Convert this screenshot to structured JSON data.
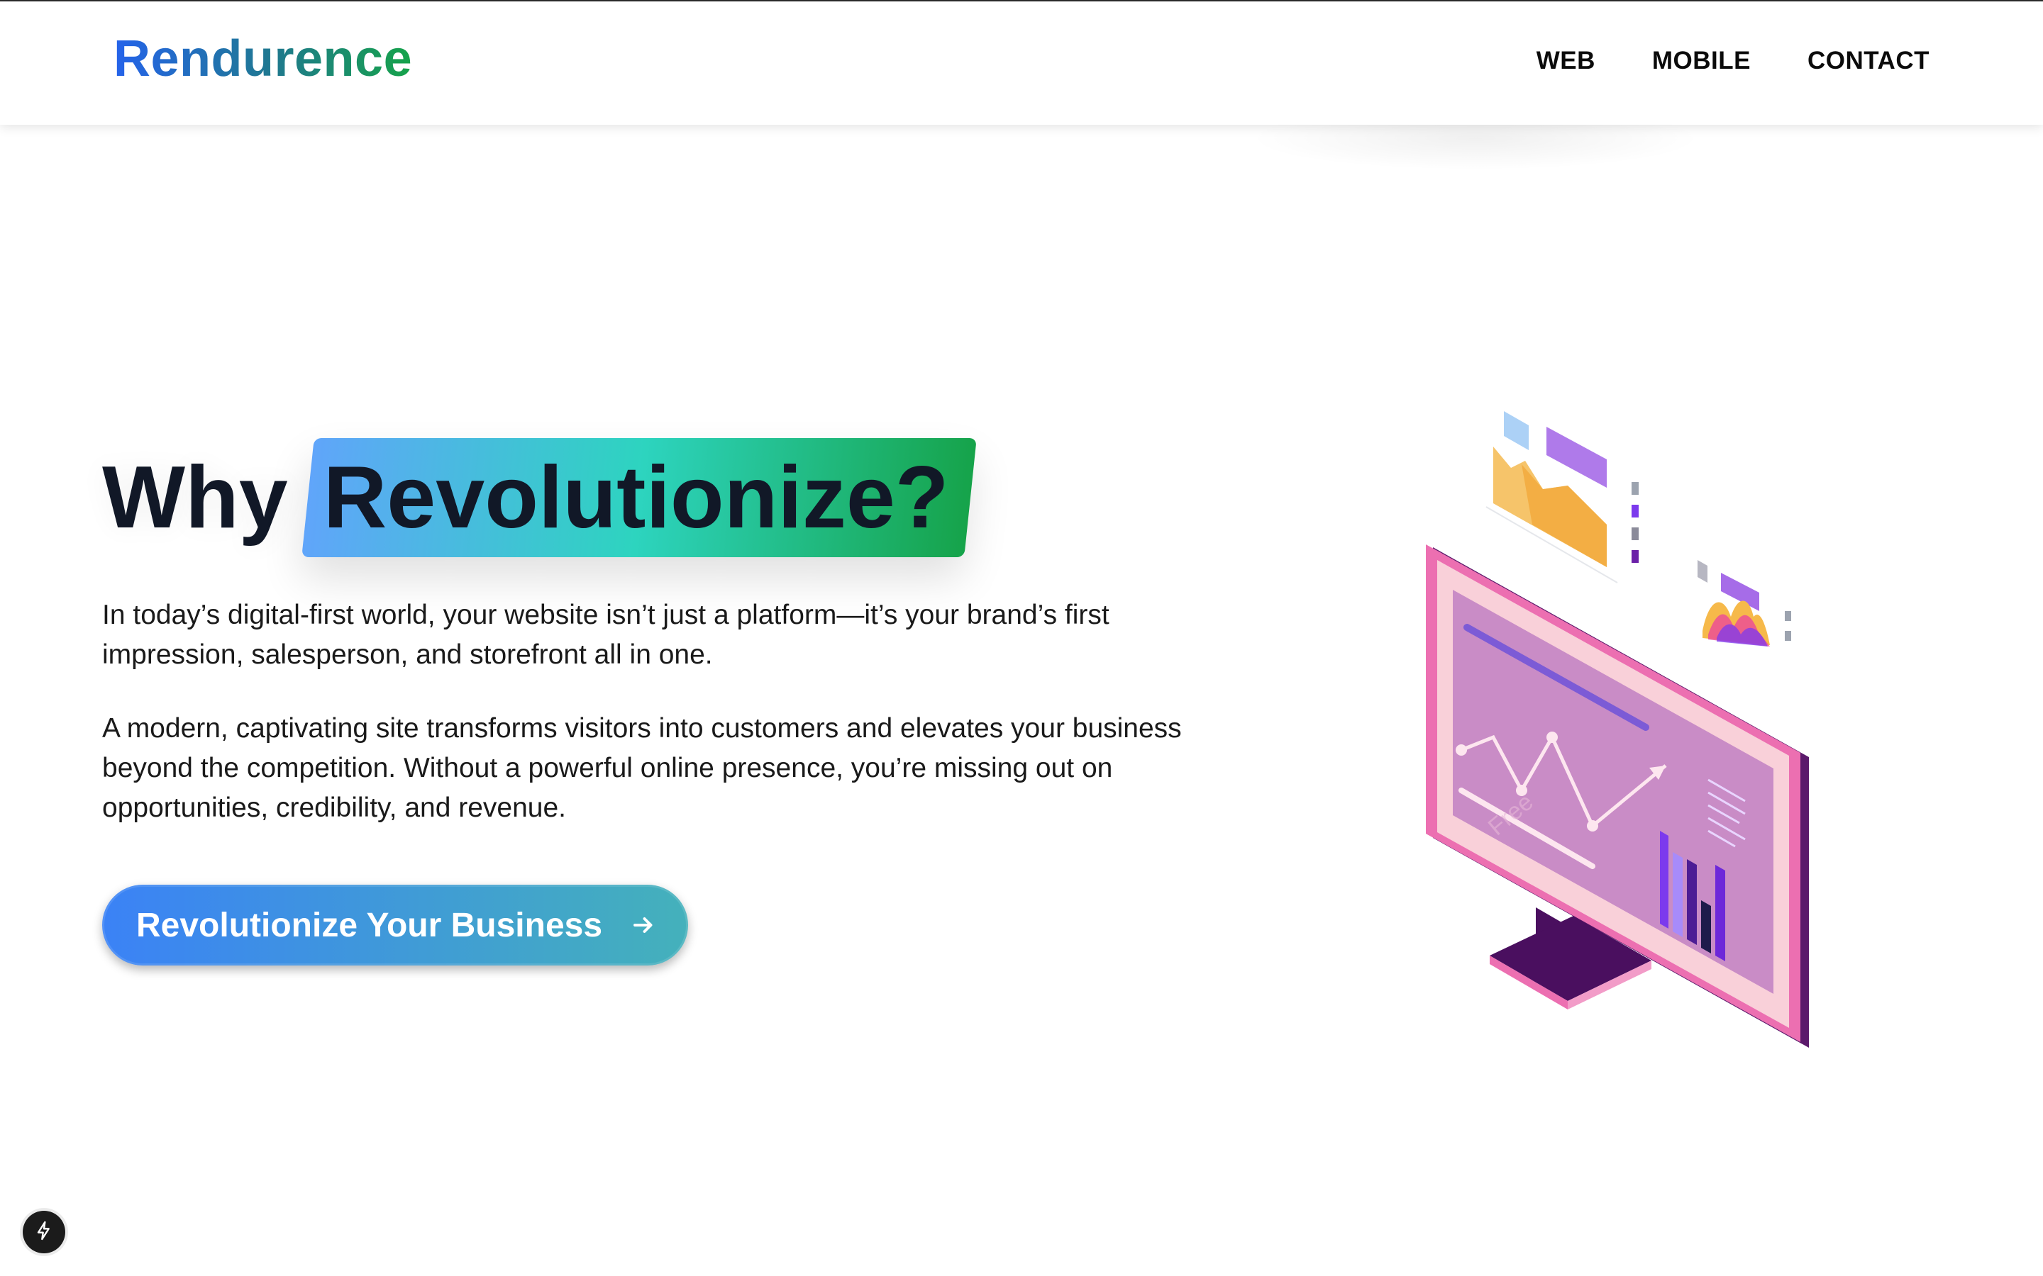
{
  "header": {
    "logo": "Rendurence",
    "nav": [
      {
        "label": "WEB"
      },
      {
        "label": "MOBILE"
      },
      {
        "label": "CONTACT"
      }
    ]
  },
  "hero": {
    "title_plain": "Why",
    "title_highlight": "Revolutionize?",
    "paragraph_1": "In today’s digital-first world, your website isn’t just a platform—it’s your brand’s first impression, salesperson, and storefront all in one.",
    "paragraph_2": "A modern, captivating site transforms visitors into customers and elevates your business beyond the competition. Without a powerful online presence, you’re missing out on opportunities, credibility, and revenue.",
    "cta_label": "Revolutionize Your Business",
    "cta_icon": "arrow-right-icon"
  },
  "illustration": {
    "subject": "isometric-monitor-analytics",
    "watermark": "Free"
  },
  "corner_badge": {
    "icon": "lightning-icon"
  },
  "colors": {
    "brand_blue": "#2563eb",
    "brand_green": "#16a34a",
    "highlight_start": "#60a5fa",
    "highlight_mid": "#2dd4bf",
    "highlight_end": "#16a34a",
    "cta_start": "#3b82f6",
    "cta_end": "#44b1bb",
    "monitor_frame": "#ec6fb1",
    "monitor_screen": "#c98cc6"
  }
}
